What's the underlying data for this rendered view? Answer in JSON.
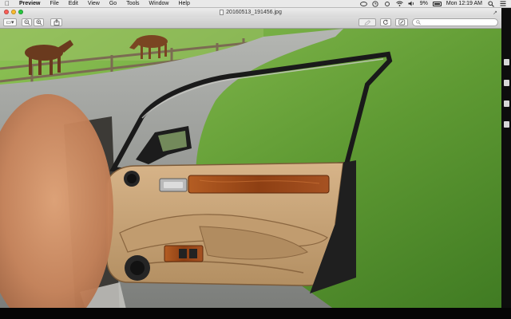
{
  "menubar": {
    "apple_icon": "apple-icon",
    "app_name": "Preview",
    "menus": [
      "File",
      "Edit",
      "View",
      "Go",
      "Tools",
      "Window",
      "Help"
    ],
    "clock": "Mon 12:19 AM",
    "battery_percent": "9%",
    "battery_level": 0.09,
    "status_icons": [
      "creative-cloud-icon",
      "time-machine-icon",
      "sync-icon",
      "wifi-icon",
      "volume-icon",
      "battery-icon",
      "search-icon",
      "list-icon"
    ]
  },
  "window": {
    "title": "20160513_191456.jpg",
    "toolbar": {
      "sidebar_button_icon": "sidebar-icon",
      "zoom_out_icon": "zoom-out-icon",
      "zoom_in_icon": "zoom-in-icon",
      "share_icon": "share-icon",
      "rotate_icon": "rotate-icon",
      "markup_icon": "pen-icon",
      "search_placeholder": ""
    }
  },
  "colors": {
    "menubar_bg": "#e9e9e9",
    "grass": "#6f9a3e",
    "door_leather": "#c8a57b",
    "wood_trim": "#9b4b1c"
  }
}
